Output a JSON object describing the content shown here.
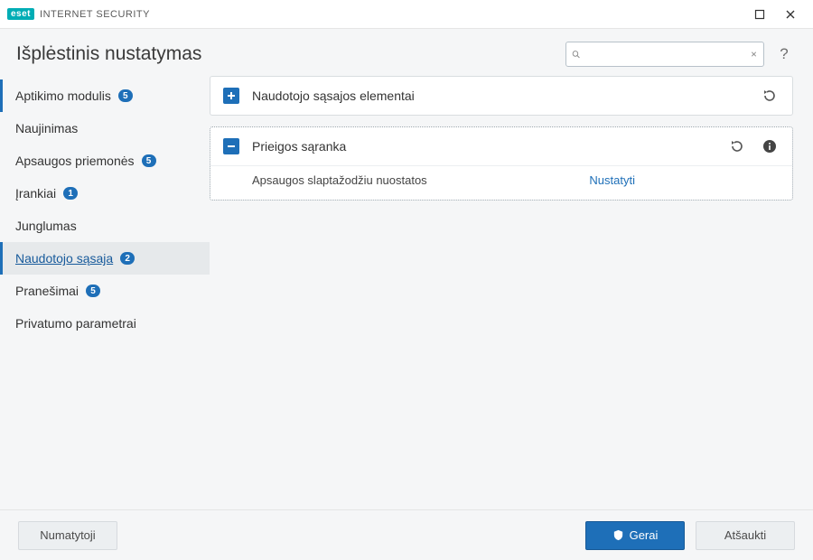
{
  "titlebar": {
    "brand_badge": "eset",
    "product_name": "INTERNET SECURITY"
  },
  "header": {
    "page_title": "Išplėstinis nustatymas",
    "search_placeholder": "",
    "help_label": "?"
  },
  "sidebar": {
    "items": [
      {
        "label": "Aptikimo modulis",
        "badge": "5"
      },
      {
        "label": "Naujinimas",
        "badge": null
      },
      {
        "label": "Apsaugos priemonės",
        "badge": "5"
      },
      {
        "label": "Įrankiai",
        "badge": "1"
      },
      {
        "label": "Junglumas",
        "badge": null
      },
      {
        "label": "Naudotojo sąsaja",
        "badge": "2"
      },
      {
        "label": "Pranešimai",
        "badge": "5"
      },
      {
        "label": "Privatumo parametrai",
        "badge": null
      }
    ]
  },
  "panels": {
    "ui_elements": {
      "title": "Naudotojo sąsajos elementai"
    },
    "access_setup": {
      "title": "Prieigos sąranka",
      "setting_label": "Apsaugos slaptažodžiu nuostatos",
      "setting_action": "Nustatyti"
    }
  },
  "footer": {
    "default_btn": "Numatytoji",
    "ok_btn": "Gerai",
    "cancel_btn": "Atšaukti"
  }
}
